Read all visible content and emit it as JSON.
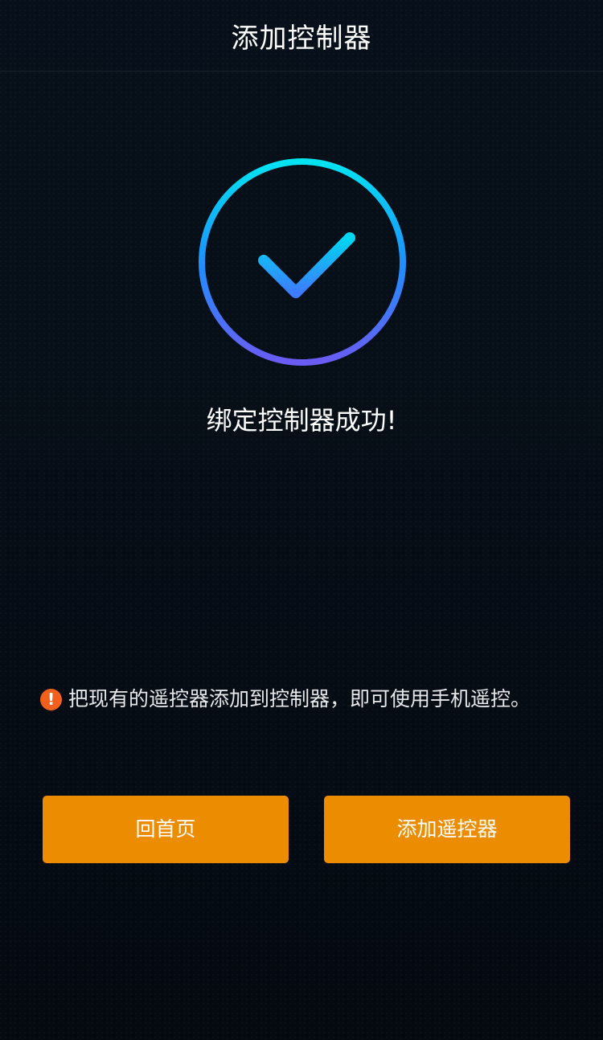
{
  "header": {
    "title": "添加控制器"
  },
  "result": {
    "icon": "check-circle-icon",
    "message": "绑定控制器成功!"
  },
  "notice": {
    "icon": "exclamation-icon",
    "icon_glyph": "!",
    "text": "把现有的遥控器添加到控制器，即可使用手机遥控。"
  },
  "actions": {
    "home_label": "回首页",
    "add_remote_label": "添加遥控器"
  },
  "colors": {
    "background": "#060b12",
    "button": "#ec8c00",
    "warning": "#f2601c",
    "ring_top": "#00e0f0",
    "ring_bottom": "#6a5cf5"
  }
}
